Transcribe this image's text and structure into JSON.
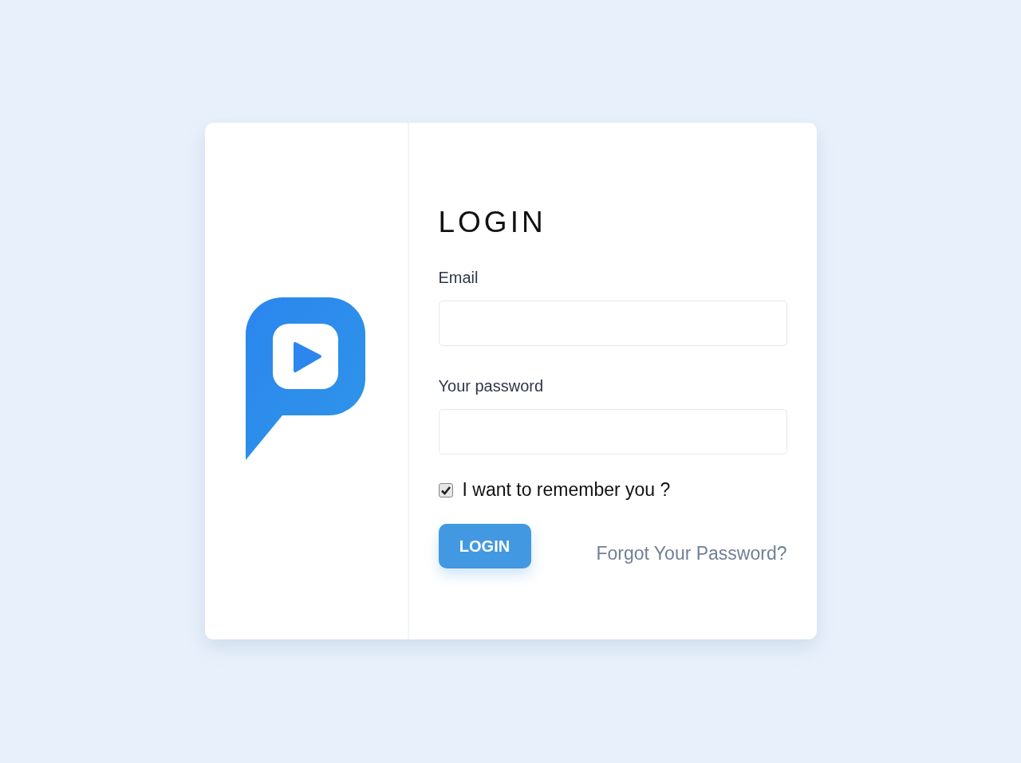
{
  "login": {
    "title": "LOGIN",
    "fields": [
      {
        "label": "Email"
      },
      {
        "label": "Your password"
      }
    ],
    "remember": {
      "label": "I want to remember you ?",
      "checked": true
    },
    "button": "LOGIN",
    "forgot_link": "Forgot Your Password?"
  }
}
